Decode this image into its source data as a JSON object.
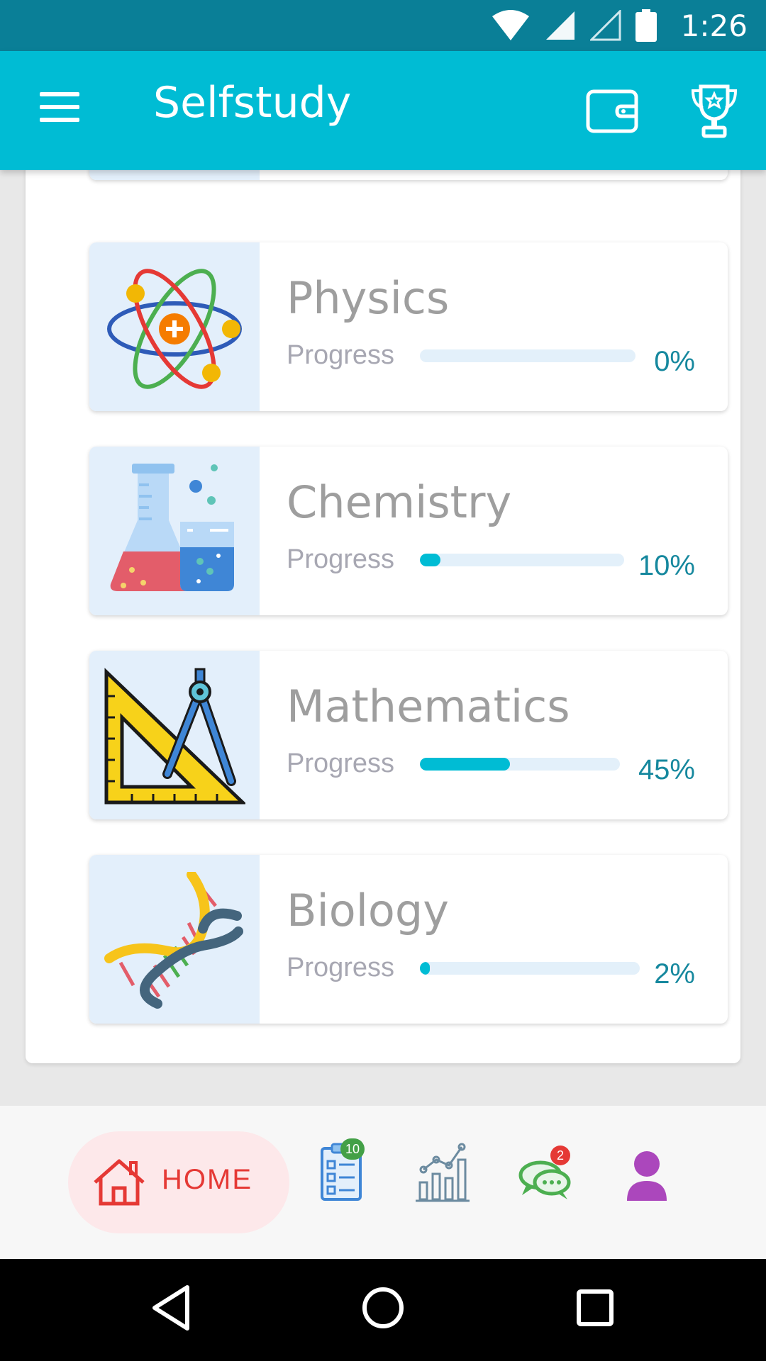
{
  "status_bar": {
    "time": "1:26"
  },
  "app_bar": {
    "title": "Selfstudy"
  },
  "subjects": [
    {
      "name": "Physics",
      "progress_label": "Progress",
      "progress": 0,
      "percent_text": "0%"
    },
    {
      "name": "Chemistry",
      "progress_label": "Progress",
      "progress": 10,
      "percent_text": "10%"
    },
    {
      "name": "Mathematics",
      "progress_label": "Progress",
      "progress": 45,
      "percent_text": "45%"
    },
    {
      "name": "Biology",
      "progress_label": "Progress",
      "progress": 2,
      "percent_text": "2%"
    }
  ],
  "bottom_nav": {
    "home_label": "HOME",
    "tasks_badge": "10",
    "chat_badge": "2"
  },
  "colors": {
    "status_bar": "#0a7f97",
    "app_bar": "#00bcd4",
    "progress_fill": "#00bcd4",
    "percent_text": "#16889e",
    "home_accent": "#e53935"
  },
  "icons": {
    "menu": "menu-icon",
    "wallet": "wallet-icon",
    "trophy": "trophy-icon",
    "home": "home-icon",
    "tasks": "clipboard-checklist-icon",
    "stats": "bar-chart-icon",
    "chat": "chat-bubbles-icon",
    "profile": "user-icon"
  }
}
